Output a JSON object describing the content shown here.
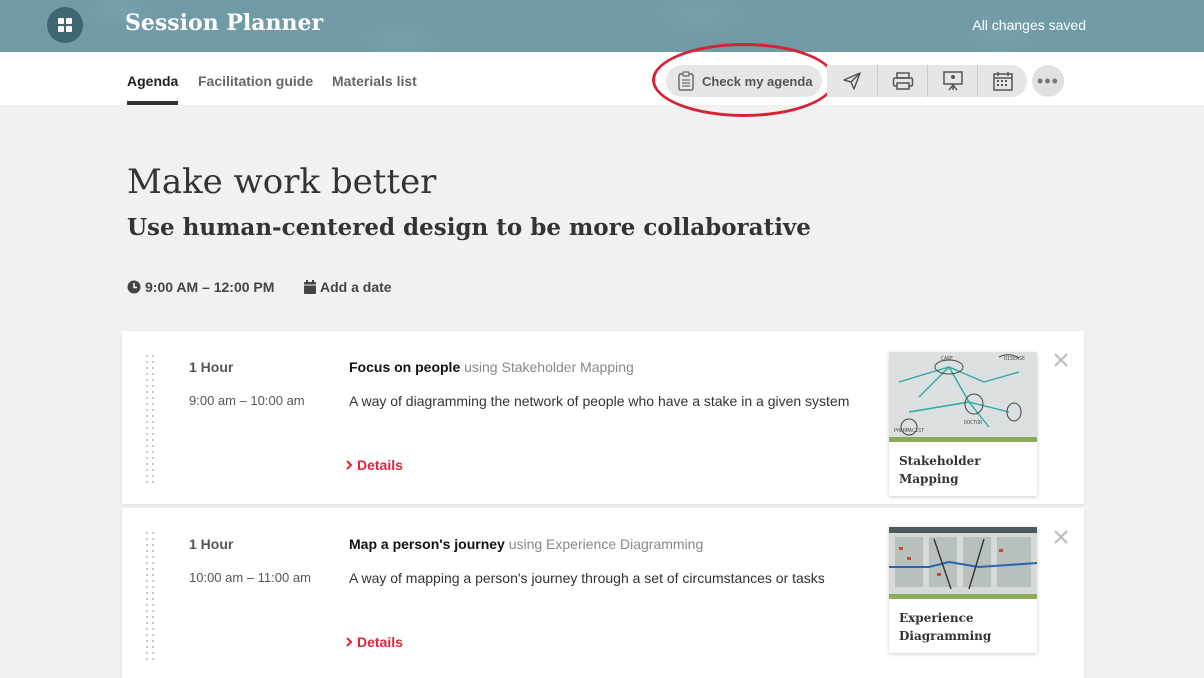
{
  "app": {
    "title": "Session Planner",
    "save_status": "All changes saved"
  },
  "tabs": [
    {
      "label": "Agenda",
      "active": true
    },
    {
      "label": "Facilitation guide",
      "active": false
    },
    {
      "label": "Materials list",
      "active": false
    }
  ],
  "toolbar": {
    "check_label": "Check my agenda",
    "tools": [
      "send-icon",
      "print-icon",
      "presentation-icon",
      "calendar-icon"
    ],
    "more_label": "•••"
  },
  "session": {
    "title": "Make work better",
    "subtitle": "Use human-centered design to be more collaborative",
    "time": "9:00 AM – 12:00 PM",
    "add_date": "Add a date"
  },
  "agenda": [
    {
      "duration": "1 Hour",
      "time_range": "9:00 am – 10:00 am",
      "title": "Focus on people",
      "using": "using Stakeholder Mapping",
      "description": "A way of diagramming the network of people who have a stake in a given system",
      "details_label": "Details",
      "method_card": "Stakeholder Mapping"
    },
    {
      "duration": "1 Hour",
      "time_range": "10:00 am – 11:00 am",
      "title": "Map a person's journey",
      "using": "using Experience Diagramming",
      "description": "A way of mapping a person's journey through a set of circumstances or tasks",
      "details_label": "Details",
      "method_card": "Experience Diagramming"
    }
  ],
  "colors": {
    "header": "#6f9aa6",
    "accent_red": "#e2233b",
    "highlight_ring": "#d42334",
    "card_bar": "#8aab5a"
  }
}
